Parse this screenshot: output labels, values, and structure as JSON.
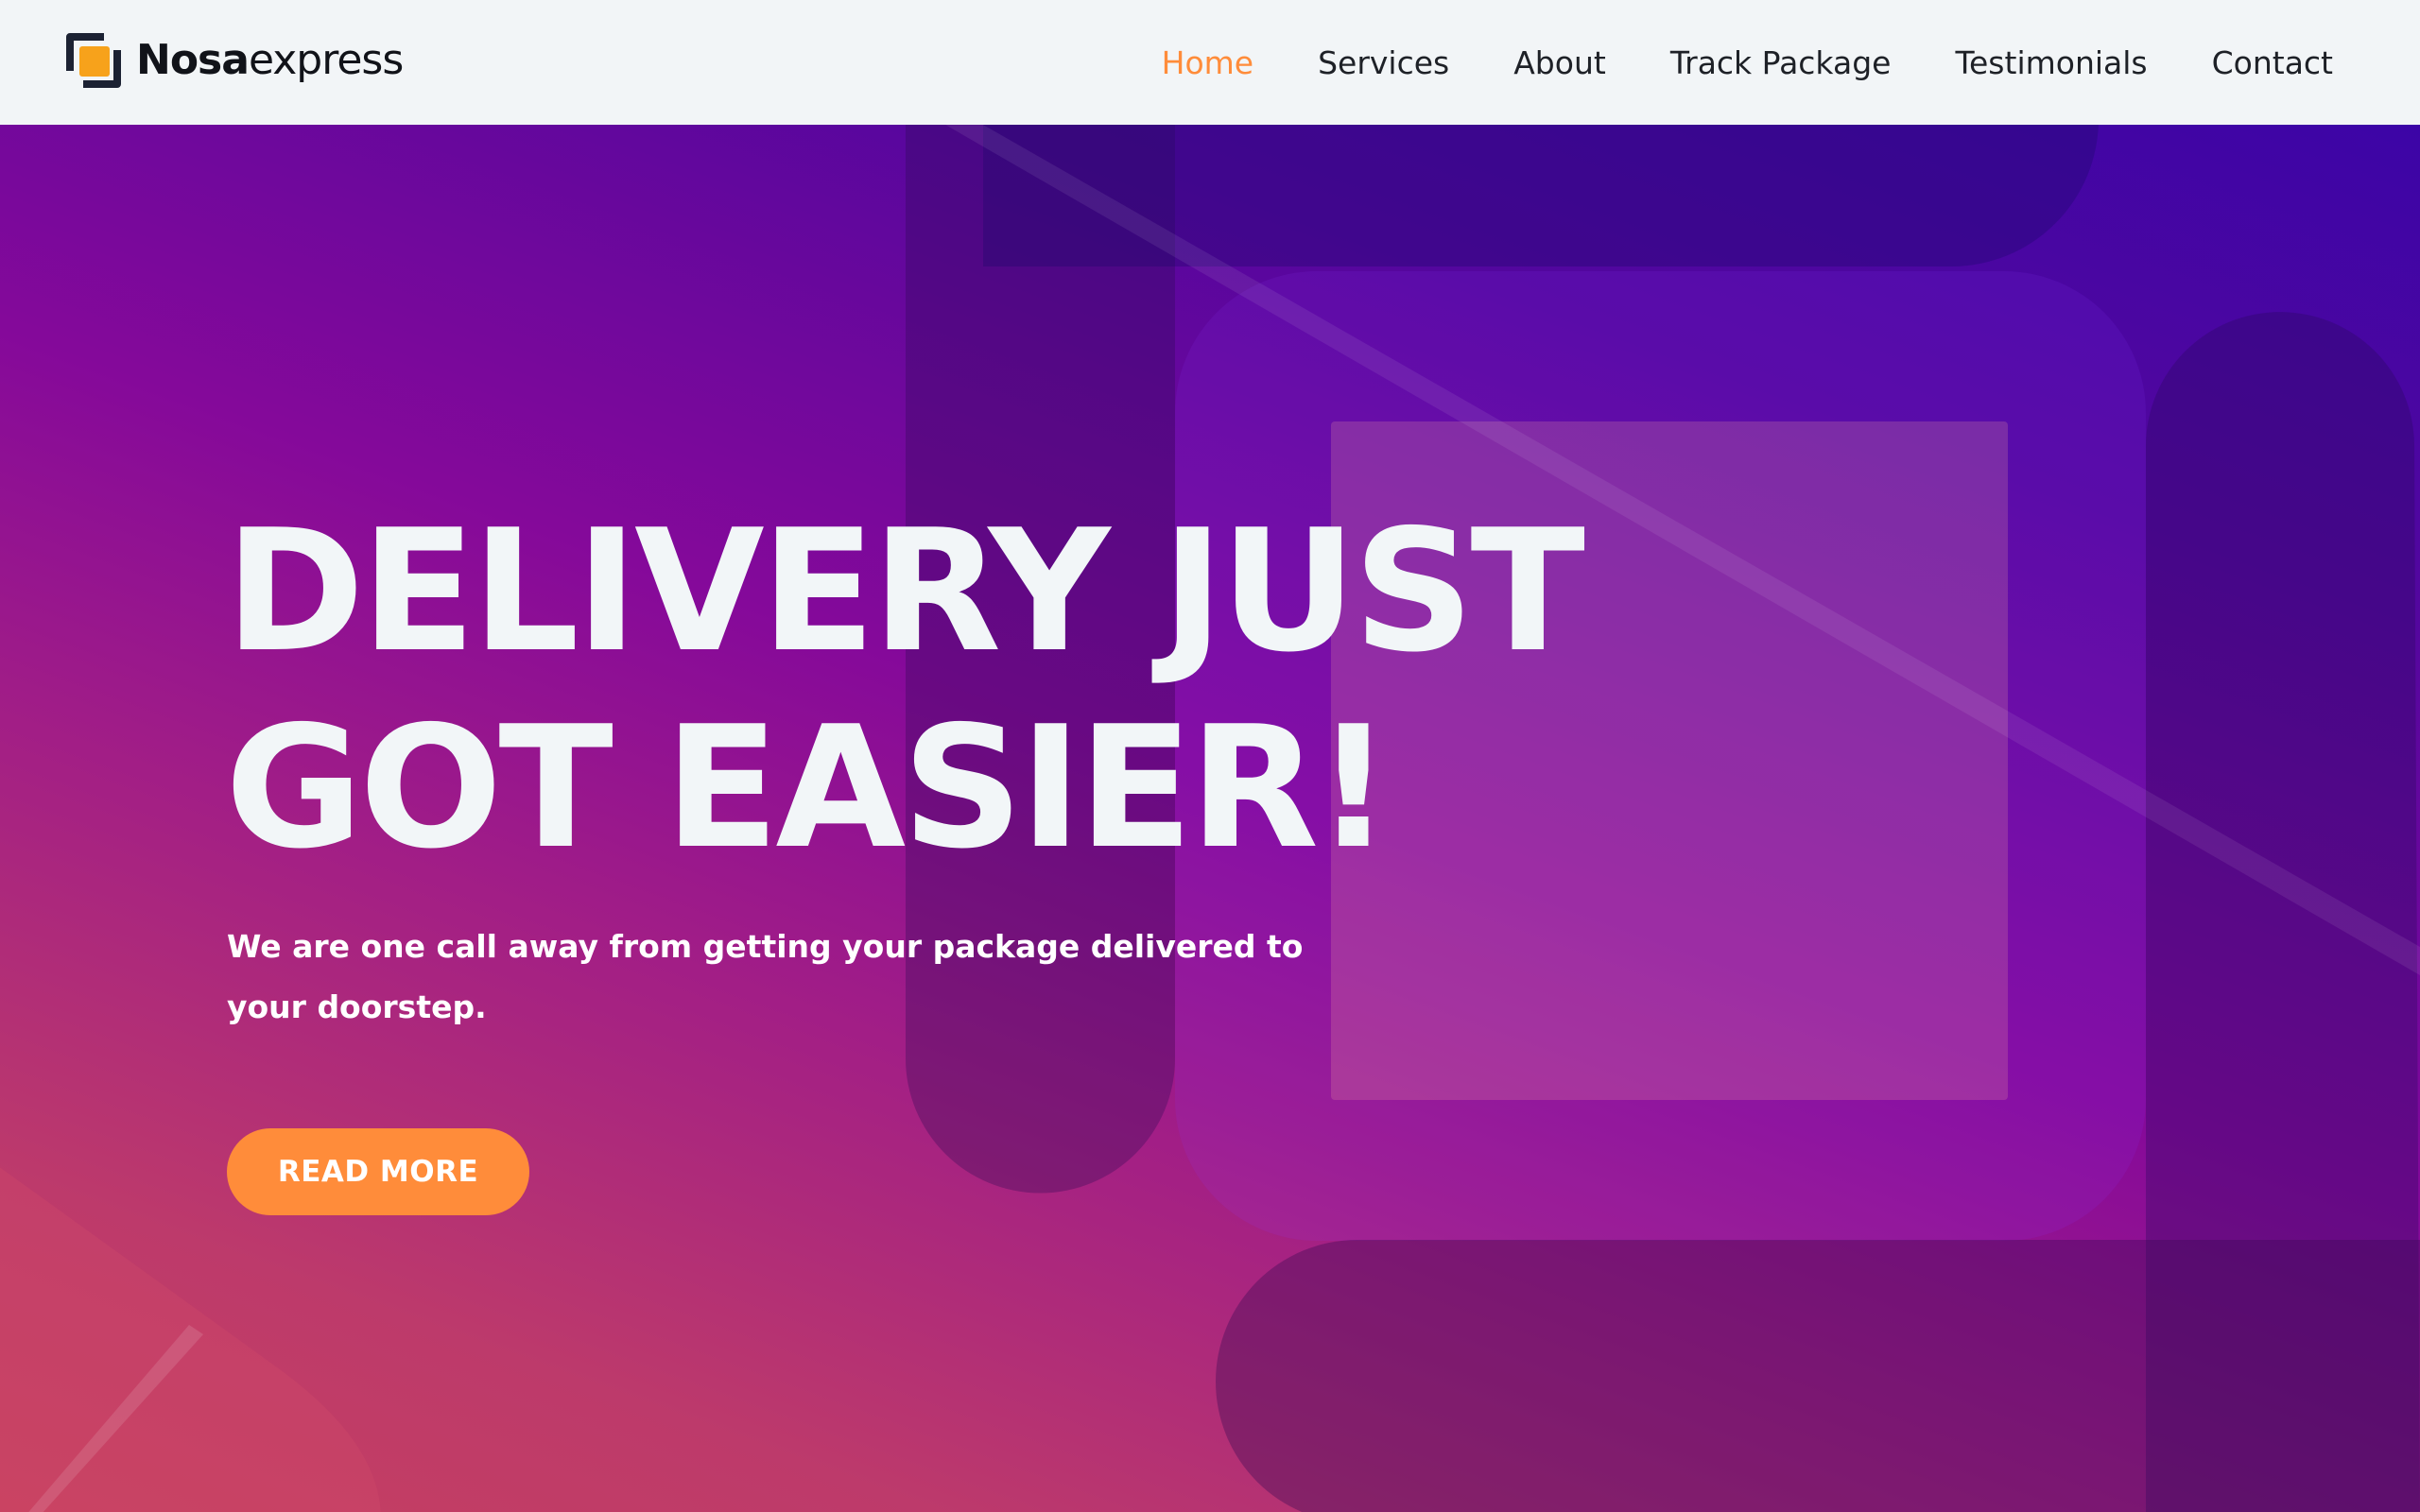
{
  "brand": {
    "name_bold": "Nosa",
    "name_light": "express",
    "accent": "#f7a21b",
    "dark": "#1c2233"
  },
  "nav": {
    "items": [
      {
        "label": "Home",
        "active": true
      },
      {
        "label": "Services",
        "active": false
      },
      {
        "label": "About",
        "active": false
      },
      {
        "label": "Track Package",
        "active": false
      },
      {
        "label": "Testimonials",
        "active": false
      },
      {
        "label": "Contact",
        "active": false
      }
    ],
    "active_color": "#ff8c3a"
  },
  "hero": {
    "title_line1": "DELIVERY JUST",
    "title_line2": "GOT EASIER!",
    "subtitle": "We are one call away from getting your package delivered to your doorstep.",
    "cta_label": "READ MORE",
    "cta_color": "#ff8c3a",
    "gradient_colors": [
      "#3c05a6",
      "#85099a",
      "#c6405f"
    ]
  }
}
